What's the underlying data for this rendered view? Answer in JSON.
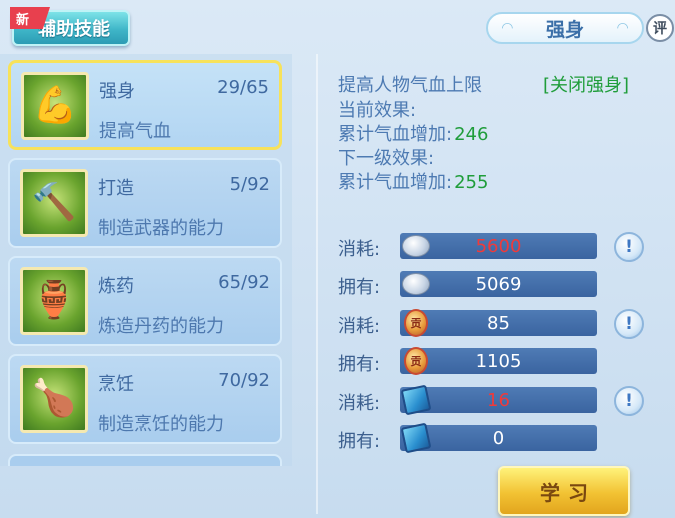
{
  "tab": {
    "label": "辅助技能",
    "new_badge": "新"
  },
  "header": {
    "title": "强身",
    "rate_label": "评"
  },
  "skills": [
    {
      "name": "强身",
      "level": "29/65",
      "desc": "提高气血",
      "icon": "muscle-man-icon",
      "selected": true
    },
    {
      "name": "打造",
      "level": "5/92",
      "desc": "制造武器的能力",
      "icon": "hammer-anvil-icon",
      "selected": false
    },
    {
      "name": "炼药",
      "level": "65/92",
      "desc": "炼造丹药的能力",
      "icon": "alchemy-pot-icon",
      "selected": false
    },
    {
      "name": "烹饪",
      "level": "70/92",
      "desc": "制造烹饪的能力",
      "icon": "drumstick-icon",
      "selected": false
    }
  ],
  "detail": {
    "description": "提高人物气血上限",
    "close_link": "[关闭强身]",
    "current_effect_label": "当前效果:",
    "current_bonus_label": "累计气血增加:",
    "current_bonus_value": "246",
    "next_effect_label": "下一级效果:",
    "next_bonus_label": "累计气血增加:",
    "next_bonus_value": "255"
  },
  "resources": [
    {
      "label": "消耗:",
      "value": "5600",
      "icon": "silver-coin-icon",
      "insufficient": true,
      "help": true
    },
    {
      "label": "拥有:",
      "value": "5069",
      "icon": "silver-coin-icon",
      "insufficient": false,
      "help": false
    },
    {
      "label": "消耗:",
      "value": "85",
      "icon": "contribution-medal-icon",
      "insufficient": false,
      "help": true
    },
    {
      "label": "拥有:",
      "value": "1105",
      "icon": "contribution-medal-icon",
      "insufficient": false,
      "help": false
    },
    {
      "label": "消耗:",
      "value": "16",
      "icon": "skill-book-icon",
      "insufficient": true,
      "help": true
    },
    {
      "label": "拥有:",
      "value": "0",
      "icon": "skill-book-icon",
      "insufficient": false,
      "help": false
    }
  ],
  "medal_glyph": "贡",
  "help_glyph": "!",
  "learn_button": "学习",
  "colors": {
    "insufficient": "#f03a3a",
    "bonus": "#1f9d3a",
    "accent_gold": "#f2c233"
  }
}
